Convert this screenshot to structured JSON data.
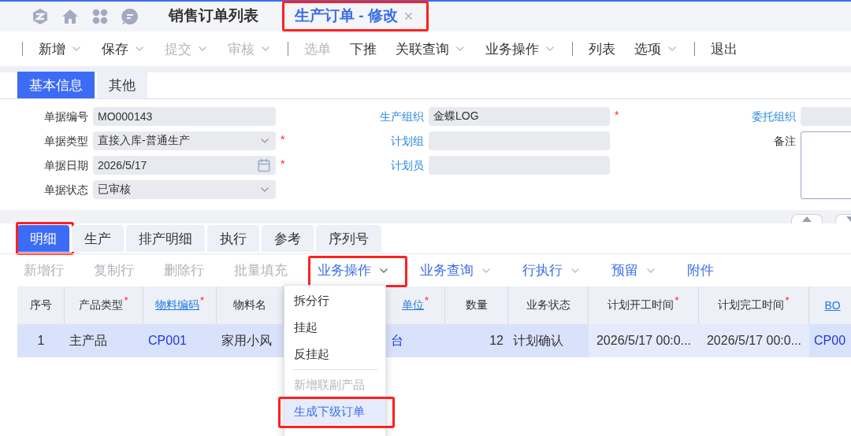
{
  "page_tabs": [
    {
      "label": "销售订单列表",
      "selected": false,
      "closable": false,
      "highlighted": false
    },
    {
      "label": "生产订单 - 修改",
      "selected": true,
      "closable": true,
      "highlighted": true
    }
  ],
  "toolbar": [
    {
      "kind": "separator"
    },
    {
      "kind": "button",
      "label": "新增",
      "dropdown": true,
      "disabled": false
    },
    {
      "kind": "button",
      "label": "保存",
      "dropdown": true,
      "disabled": false
    },
    {
      "kind": "button",
      "label": "提交",
      "dropdown": true,
      "disabled": true
    },
    {
      "kind": "button",
      "label": "审核",
      "dropdown": true,
      "disabled": true
    },
    {
      "kind": "separator"
    },
    {
      "kind": "button",
      "label": "选单",
      "dropdown": false,
      "disabled": true
    },
    {
      "kind": "button",
      "label": "下推",
      "dropdown": false,
      "disabled": false
    },
    {
      "kind": "button",
      "label": "关联查询",
      "dropdown": true,
      "disabled": false
    },
    {
      "kind": "button",
      "label": "业务操作",
      "dropdown": true,
      "disabled": false
    },
    {
      "kind": "separator"
    },
    {
      "kind": "button",
      "label": "列表",
      "dropdown": false,
      "disabled": false
    },
    {
      "kind": "button",
      "label": "选项",
      "dropdown": true,
      "disabled": false
    },
    {
      "kind": "separator"
    },
    {
      "kind": "button",
      "label": "退出",
      "dropdown": false,
      "disabled": false
    }
  ],
  "form_tabs": [
    {
      "label": "基本信息",
      "selected": true
    },
    {
      "label": "其他",
      "selected": false
    }
  ],
  "form": {
    "left": [
      {
        "label": "单据编号",
        "value": "MO000143",
        "kind": "text",
        "link": false
      },
      {
        "label": "单据类型",
        "value": "直接入库-普通生产",
        "kind": "select",
        "required_mark": "*",
        "link": false
      },
      {
        "label": "单据日期",
        "value": "2026/5/17",
        "kind": "date",
        "required_mark": "*",
        "link": false
      },
      {
        "label": "单据状态",
        "value": "已审核",
        "kind": "select",
        "link": false
      }
    ],
    "middle": [
      {
        "label": "生产组织",
        "value": "金蝶LOG",
        "kind": "text",
        "required_mark": "*",
        "link": true
      },
      {
        "label": "计划组",
        "kind": "text",
        "link": true
      },
      {
        "label": "计划员",
        "kind": "text",
        "link": true
      }
    ],
    "right": [
      {
        "label": "委托组织",
        "kind": "text",
        "link": true
      },
      {
        "label": "备注",
        "kind": "textarea",
        "link": false
      }
    ]
  },
  "detail_tabs": [
    {
      "label": "明细",
      "selected": true,
      "highlighted": true
    },
    {
      "label": "生产",
      "selected": false,
      "highlighted": false
    },
    {
      "label": "排产明细",
      "selected": false,
      "highlighted": false
    },
    {
      "label": "执行",
      "selected": false,
      "highlighted": false
    },
    {
      "label": "参考",
      "selected": false,
      "highlighted": false
    },
    {
      "label": "序列号",
      "selected": false,
      "highlighted": false
    }
  ],
  "row_toolbar": [
    {
      "label": "新增行",
      "disabled": true,
      "dropdown": false,
      "highlighted": false
    },
    {
      "label": "复制行",
      "disabled": true,
      "dropdown": false,
      "highlighted": false
    },
    {
      "label": "删除行",
      "disabled": true,
      "dropdown": false,
      "highlighted": false
    },
    {
      "label": "批量填充",
      "disabled": true,
      "dropdown": false,
      "highlighted": false
    },
    {
      "label": "业务操作",
      "disabled": false,
      "dropdown": true,
      "highlighted": true
    },
    {
      "label": "业务查询",
      "disabled": false,
      "dropdown": true,
      "highlighted": false
    },
    {
      "label": "行执行",
      "disabled": false,
      "dropdown": true,
      "highlighted": false
    },
    {
      "label": "预留",
      "disabled": false,
      "dropdown": true,
      "highlighted": false
    },
    {
      "label": "附件",
      "disabled": false,
      "dropdown": false,
      "highlighted": false
    }
  ],
  "menu": {
    "items": [
      {
        "kind": "item",
        "label": "拆分行",
        "disabled": false,
        "selected": false,
        "highlighted": false
      },
      {
        "kind": "item",
        "label": "挂起",
        "disabled": false,
        "selected": false,
        "highlighted": false
      },
      {
        "kind": "item",
        "label": "反挂起",
        "disabled": false,
        "selected": false,
        "highlighted": false
      },
      {
        "kind": "divider"
      },
      {
        "kind": "item",
        "label": "新增联副产品",
        "disabled": true,
        "selected": false,
        "highlighted": false
      },
      {
        "kind": "item",
        "label": "生成下级订单",
        "disabled": false,
        "selected": true,
        "highlighted": true
      }
    ]
  },
  "table": {
    "columns": [
      {
        "label": "序号",
        "link": false
      },
      {
        "label": "产品类型",
        "required_mark": "*",
        "link": false
      },
      {
        "label": "物料编码",
        "required_mark": "*",
        "link": true
      },
      {
        "label": "物料名",
        "link": false
      },
      {
        "label": "单位",
        "required_mark": "*",
        "link": true
      },
      {
        "label": "数量",
        "link": false
      },
      {
        "label": "业务状态",
        "link": false
      },
      {
        "label": "计划开工时间",
        "required_mark": "*",
        "link": false
      },
      {
        "label": "计划完工时间",
        "required_mark": "*",
        "link": false
      },
      {
        "label": "BO",
        "link": true
      }
    ],
    "rows": [
      {
        "selected": true,
        "cells": [
          {
            "text": "1",
            "link": false
          },
          {
            "text": "主产品",
            "link": false
          },
          {
            "text": "CP001",
            "link": true
          },
          {
            "text": "家用小风",
            "link": false
          },
          {
            "text": "台",
            "link": true
          },
          {
            "text": "12",
            "link": false
          },
          {
            "text": "计划确认",
            "link": false
          },
          {
            "text": "2026/5/17 00:0...",
            "link": false
          },
          {
            "text": "2026/5/17 00:0...",
            "link": false
          },
          {
            "text": "CP00",
            "link": true
          }
        ]
      }
    ]
  }
}
